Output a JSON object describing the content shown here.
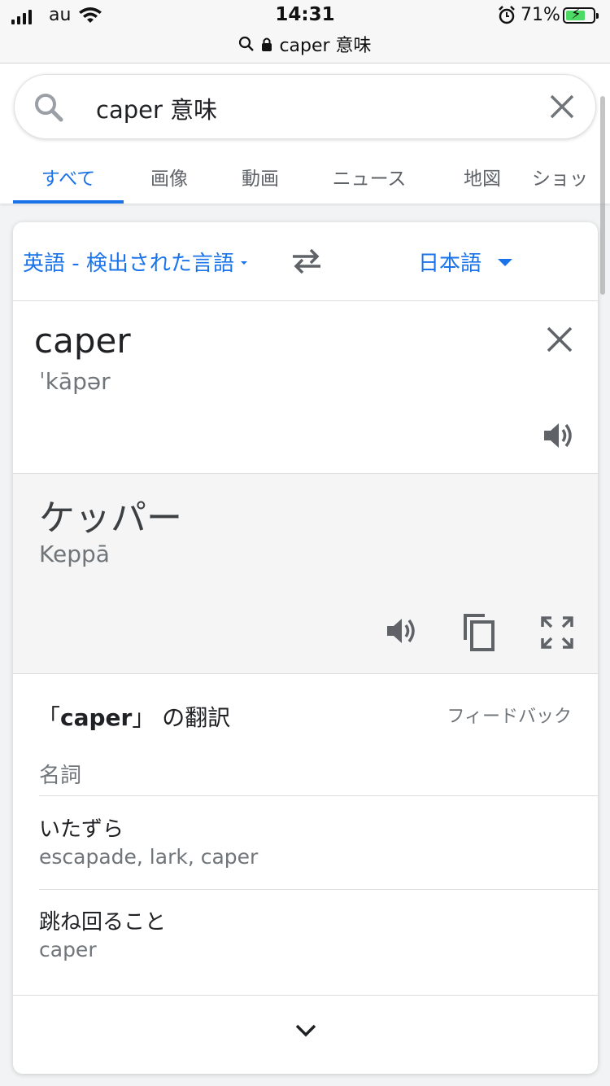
{
  "status_bar": {
    "carrier": "au",
    "time": "14:31",
    "battery_percent": "71%",
    "battery_level": 0.71
  },
  "browser": {
    "url_text": "caper 意味"
  },
  "search": {
    "query": "caper 意味"
  },
  "tabs": [
    {
      "label": "すべて",
      "active": true
    },
    {
      "label": "画像",
      "active": false
    },
    {
      "label": "動画",
      "active": false
    },
    {
      "label": "ニュース",
      "active": false
    },
    {
      "label": "地図",
      "active": false
    },
    {
      "label": "ショッ",
      "active": false
    }
  ],
  "translate": {
    "source_lang": "英語 - 検出された言語",
    "target_lang": "日本語",
    "source_word": "caper",
    "source_phonetic": "ˈkāpər",
    "target_word": "ケッパー",
    "target_romanization": "Keppā"
  },
  "dictionary": {
    "heading_prefix": "「",
    "heading_word": "caper",
    "heading_suffix": "」 の翻訳",
    "feedback_label": "フィードバック",
    "part_of_speech": "名詞",
    "entries": [
      {
        "word": "いたずら",
        "synonyms": "escapade, lark, caper"
      },
      {
        "word": "跳ね回ること",
        "synonyms": "caper"
      }
    ]
  },
  "colors": {
    "accent": "#1a73e8",
    "text_primary": "#202124",
    "text_secondary": "#70757a",
    "battery_fill": "#4cd964"
  },
  "icons": [
    "signal-icon",
    "wifi-icon",
    "alarm-icon",
    "battery-icon",
    "lock-icon",
    "search-icon",
    "close-icon",
    "swap-icon",
    "dropdown-arrow-icon",
    "speaker-icon",
    "copy-icon",
    "fullscreen-icon",
    "chevron-down-icon"
  ]
}
